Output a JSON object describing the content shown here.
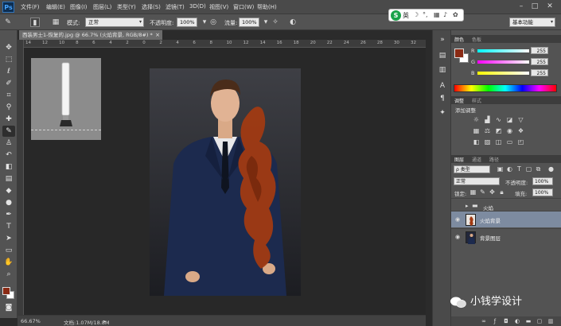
{
  "app": {
    "logo": "Ps"
  },
  "menu": [
    "文件(F)",
    "编辑(E)",
    "图像(I)",
    "图层(L)",
    "类型(Y)",
    "选择(S)",
    "滤镜(T)",
    "3D(D)",
    "视图(V)",
    "窗口(W)",
    "帮助(H)"
  ],
  "options": {
    "mode_label": "模式:",
    "mode_value": "正常",
    "opacity_label": "不透明度:",
    "opacity_value": "100%",
    "flow_label": "流量:",
    "flow_value": "100%",
    "workspace": "基本功能"
  },
  "ime": {
    "label": "英"
  },
  "document": {
    "tab_title": "西装男士1-恢复的.jpg @ 66.7% (火焰背景, RGB/8#) *",
    "zoom": "66.67%",
    "doc_info": "文档:1.07M/18.8M",
    "ruler_marks": [
      "14",
      "12",
      "10",
      "8",
      "6",
      "4",
      "2",
      "0",
      "2",
      "4",
      "6",
      "8",
      "10",
      "12",
      "14",
      "16",
      "18",
      "20",
      "22",
      "24",
      "26",
      "28",
      "30",
      "32"
    ]
  },
  "color_panel": {
    "tabs": [
      "颜色",
      "色板"
    ],
    "channels": [
      {
        "label": "R",
        "value": "255"
      },
      {
        "label": "G",
        "value": "255"
      },
      {
        "label": "B",
        "value": "255"
      }
    ]
  },
  "adjust_panel": {
    "tabs": [
      "调整",
      "样式"
    ],
    "title": "添加调整"
  },
  "layers_panel": {
    "tabs": [
      "图层",
      "通道",
      "路径"
    ],
    "filter": "ρ 类型",
    "blend_mode": "正常",
    "opacity_label": "不透明度:",
    "opacity_value": "100%",
    "lock_label": "锁定:",
    "fill_label": "填充:",
    "fill_value": "100%",
    "layers": [
      {
        "name": "火焰",
        "type": "group"
      },
      {
        "name": "火焰背景",
        "type": "layer",
        "selected": true
      },
      {
        "name": "背景图层",
        "type": "layer"
      }
    ]
  },
  "watermark": "小钱学设计",
  "colors": {
    "foreground": "#8a2a14",
    "flame": "#a13a12",
    "selection": "#7d8ba0"
  }
}
